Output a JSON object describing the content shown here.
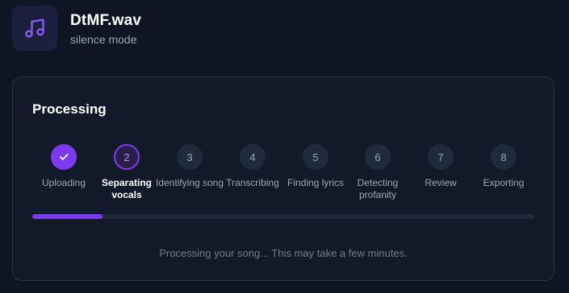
{
  "file": {
    "title": "DtMF.wav",
    "subtitle": "silence mode",
    "icon": "music-note-icon",
    "accent": "#7c3aed"
  },
  "processing": {
    "title": "Processing",
    "progress_fraction": 0.14,
    "status_message": "Processing your song... This may take a few minutes.",
    "steps": [
      {
        "number": "1",
        "label": "Uploading",
        "state": "done",
        "icon": "check-icon"
      },
      {
        "number": "2",
        "label": "Separating vocals",
        "state": "active"
      },
      {
        "number": "3",
        "label": "Identifying song",
        "state": "pending"
      },
      {
        "number": "4",
        "label": "Transcribing",
        "state": "pending"
      },
      {
        "number": "5",
        "label": "Finding lyrics",
        "state": "pending"
      },
      {
        "number": "6",
        "label": "Detecting profanity",
        "state": "pending"
      },
      {
        "number": "7",
        "label": "Review",
        "state": "pending"
      },
      {
        "number": "8",
        "label": "Exporting",
        "state": "pending"
      }
    ]
  }
}
